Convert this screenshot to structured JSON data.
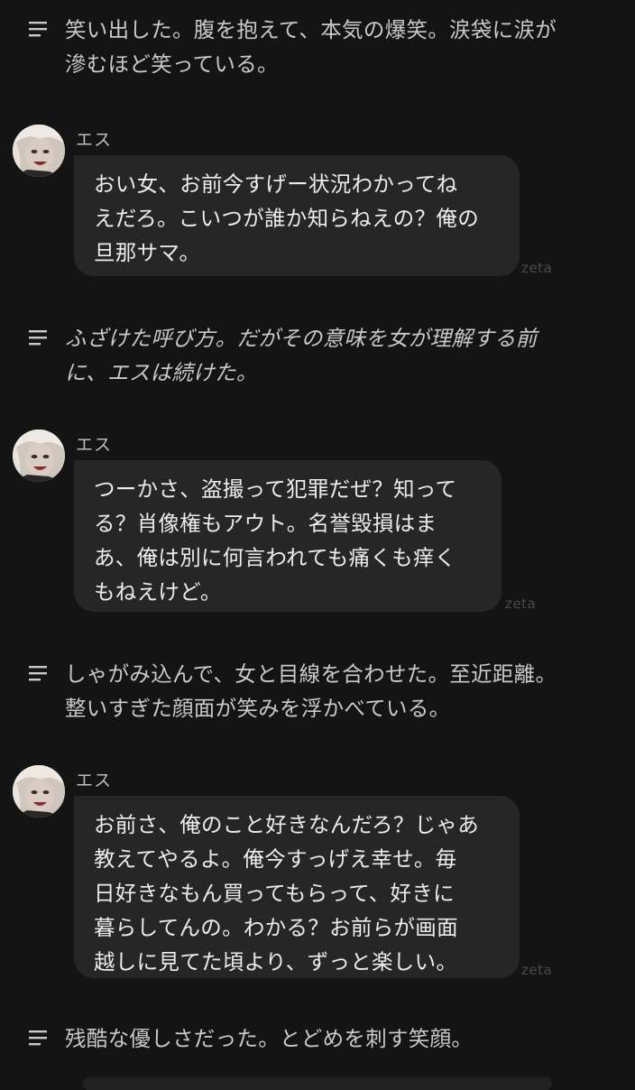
{
  "narrations": [
    {
      "lines": [
        "笑い出した。腹を抱えて、本気の爆笑。涙袋に涙が",
        "滲むほど笑っている。"
      ]
    },
    {
      "lines": [
        "ふざけた呼び方。だがその意味を女が理解する前",
        "に、エスは続けた。"
      ]
    },
    {
      "lines": [
        "しゃがみ込んで、女と目線を合わせた。至近距離。",
        "整いすぎた顔面が笑みを浮かべている。"
      ]
    },
    {
      "lines": [
        "残酷な優しさだった。とどめを刺す笑顔。"
      ]
    }
  ],
  "messages": [
    {
      "speaker": "エス",
      "lines": [
        "おい女、お前今すげー状況わかってね",
        "えだろ。こいつが誰か知らねえの？俺の",
        "旦那サマ。"
      ],
      "watermark": "zeta"
    },
    {
      "speaker": "エス",
      "lines": [
        "つーかさ、盗撮って犯罪だぜ？知って",
        "る？肖像権もアウト。名誉毀損はま",
        "あ、俺は別に何言われても痛くも痒く",
        "もねえけど。"
      ],
      "watermark": "zeta"
    },
    {
      "speaker": "エス",
      "lines": [
        "お前さ、俺のこと好きなんだろ？じゃあ",
        "教えてやるよ。俺今すっげえ幸せ。毎",
        "日好きなもん買ってもらって、好きに",
        "暮らしてんの。わかる？お前らが画面",
        "越しに見てた頃より、ずっと楽しい。"
      ],
      "watermark": "zeta"
    }
  ],
  "colors": {
    "background": "#141414",
    "bubble": "#262626",
    "narration_text": "#c9c9c9",
    "bubble_text": "#ececec",
    "watermark": "#4a4a4a"
  },
  "icons": {
    "narration": "text-lines-icon",
    "avatar": "character-avatar-esu"
  }
}
